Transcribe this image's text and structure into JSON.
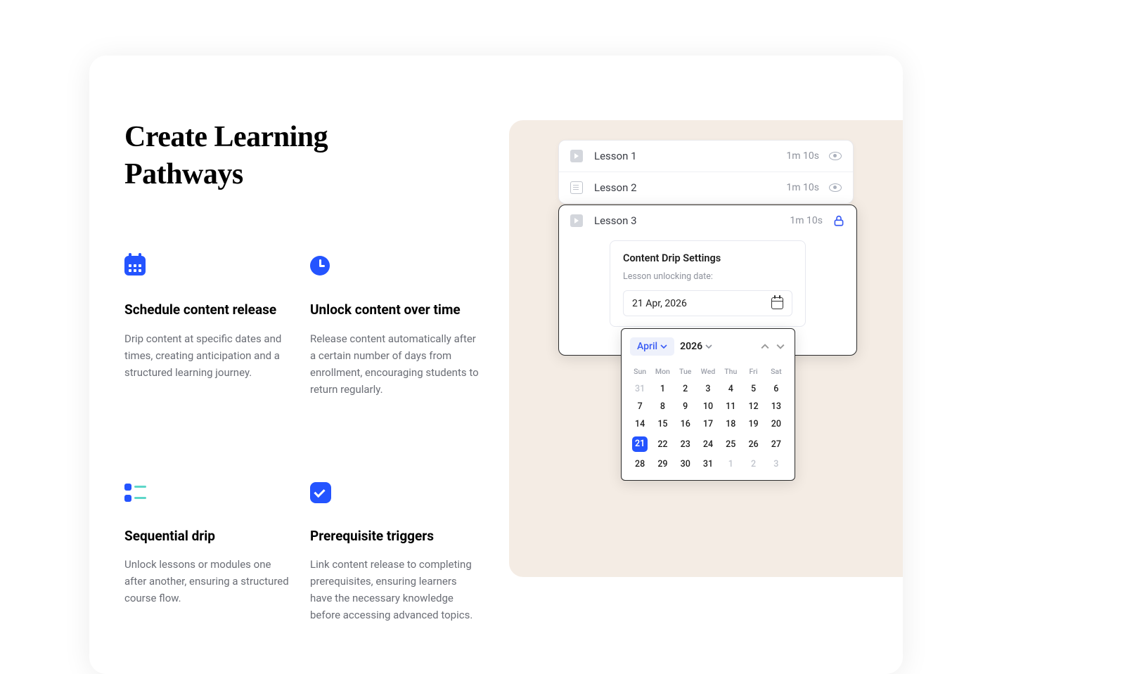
{
  "heading": "Create Learning Pathways",
  "features": [
    {
      "title": "Schedule content release",
      "desc": "Drip content at specific dates and times, creating anticipation and a structured learning journey."
    },
    {
      "title": "Unlock content over time",
      "desc": "Release content automatically after a certain number of days from enrollment, encouraging students to return regularly."
    },
    {
      "title": "Sequential drip",
      "desc": "Unlock lessons or modules one after another, ensuring a structured course flow."
    },
    {
      "title": "Prerequisite triggers",
      "desc": "Link content release to completing prerequisites, ensuring learners have the necessary knowledge before accessing advanced topics."
    }
  ],
  "lessons": [
    {
      "name": "Lesson 1",
      "duration": "1m 10s"
    },
    {
      "name": "Lesson 2",
      "duration": "1m 10s"
    },
    {
      "name": "Lesson 3",
      "duration": "1m 10s"
    }
  ],
  "drip": {
    "title": "Content Drip Settings",
    "label": "Lesson unlocking date:",
    "date_value": "21 Apr,  2026"
  },
  "calendar": {
    "month": "April",
    "year": "2026",
    "dow": [
      "Sun",
      "Mon",
      "Tue",
      "Wed",
      "Thu",
      "Fri",
      "Sat"
    ],
    "selected_day": 21,
    "weeks": [
      [
        {
          "d": 31,
          "dim": true
        },
        {
          "d": 1
        },
        {
          "d": 2
        },
        {
          "d": 3
        },
        {
          "d": 4
        },
        {
          "d": 5
        },
        {
          "d": 6
        }
      ],
      [
        {
          "d": 7
        },
        {
          "d": 8
        },
        {
          "d": 9
        },
        {
          "d": 10
        },
        {
          "d": 11
        },
        {
          "d": 12
        },
        {
          "d": 13
        }
      ],
      [
        {
          "d": 14
        },
        {
          "d": 15
        },
        {
          "d": 16
        },
        {
          "d": 17
        },
        {
          "d": 18
        },
        {
          "d": 19
        },
        {
          "d": 20
        }
      ],
      [
        {
          "d": 21,
          "sel": true
        },
        {
          "d": 22
        },
        {
          "d": 23
        },
        {
          "d": 24
        },
        {
          "d": 25
        },
        {
          "d": 26
        },
        {
          "d": 27
        }
      ],
      [
        {
          "d": 28
        },
        {
          "d": 29
        },
        {
          "d": 30
        },
        {
          "d": 31
        },
        {
          "d": 1,
          "dim": true
        },
        {
          "d": 2,
          "dim": true
        },
        {
          "d": 3,
          "dim": true
        }
      ]
    ]
  }
}
